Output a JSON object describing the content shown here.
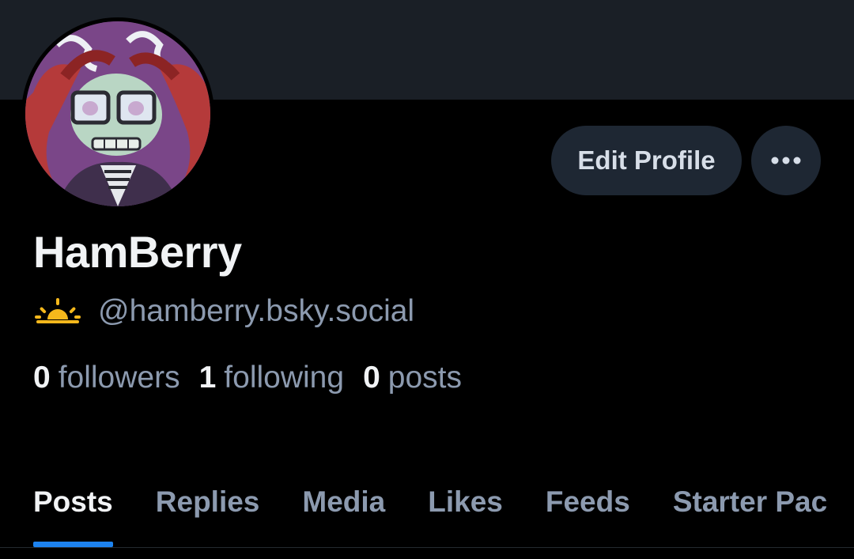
{
  "profile": {
    "display_name": "HamBerry",
    "handle": "@hamberry.bsky.social",
    "handle_icon": "sunrise-icon",
    "avatar": "skeleton-character-avatar"
  },
  "actions": {
    "edit_label": "Edit Profile",
    "more_icon": "more-horizontal-icon"
  },
  "stats": [
    {
      "count": "0",
      "label": "followers"
    },
    {
      "count": "1",
      "label": "following"
    },
    {
      "count": "0",
      "label": "posts"
    }
  ],
  "tabs": [
    {
      "label": "Posts",
      "active": true
    },
    {
      "label": "Replies"
    },
    {
      "label": "Media"
    },
    {
      "label": "Likes"
    },
    {
      "label": "Feeds"
    },
    {
      "label": "Starter Pac"
    }
  ],
  "colors": {
    "background": "#000000",
    "banner": "#1a1f26",
    "button_bg": "#1e2733",
    "muted_text": "#8c9aaf",
    "accent": "#1d83f0",
    "sun": "#f5b81c"
  }
}
